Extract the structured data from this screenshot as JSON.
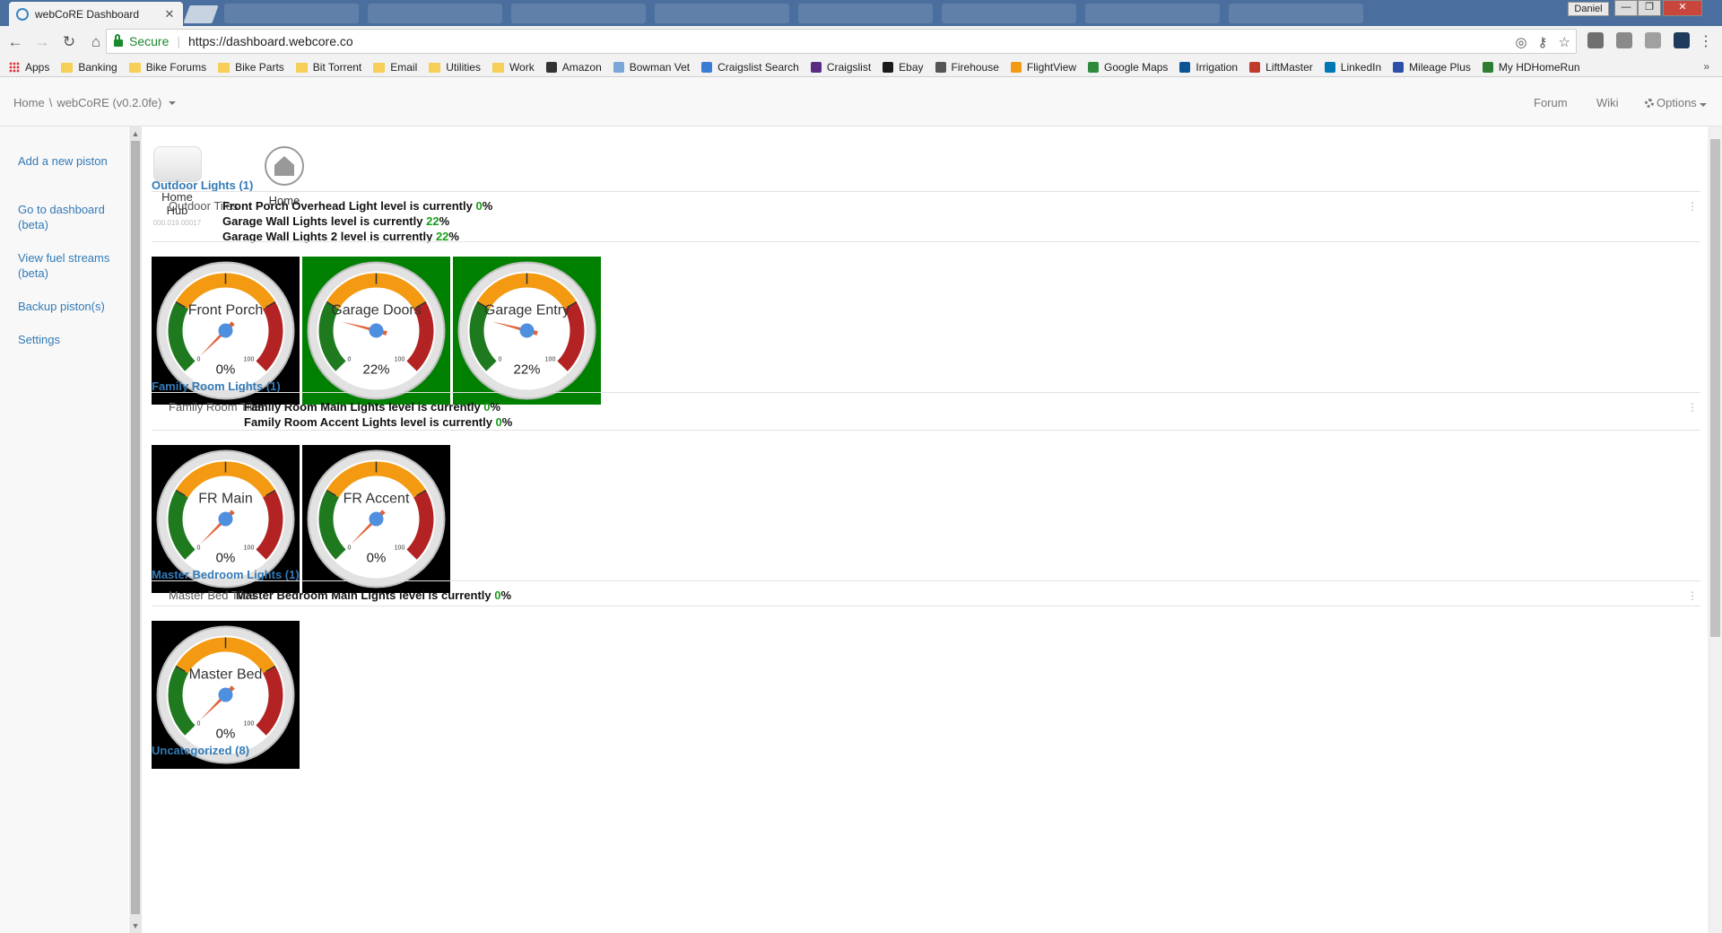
{
  "browser": {
    "tab_title": "webCoRE Dashboard",
    "security_label": "Secure",
    "url": "https://dashboard.webcore.co",
    "profile_name": "Daniel"
  },
  "bookmarks": [
    "Apps",
    "Banking",
    "Bike Forums",
    "Bike Parts",
    "Bit Torrent",
    "Email",
    "Utilities",
    "Work",
    "Amazon",
    "Bowman Vet",
    "Craigslist Search",
    "Craigslist",
    "Ebay",
    "Firehouse",
    "FlightView",
    "Google Maps",
    "Irrigation",
    "LiftMaster",
    "LinkedIn",
    "Mileage Plus",
    "My HDHomeRun"
  ],
  "header": {
    "home": "Home",
    "separator": "\\",
    "app": "webCoRE (v0.2.0fe)",
    "forum": "Forum",
    "wiki": "Wiki",
    "options": "Options"
  },
  "sidebar": {
    "items": [
      {
        "label": "Add a new piston"
      },
      {
        "label": "Go to dashboard (beta)"
      },
      {
        "label": "View fuel streams (beta)"
      },
      {
        "label": "Backup piston(s)"
      },
      {
        "label": "Settings"
      }
    ]
  },
  "devices": [
    {
      "label": "Home Hub",
      "sub": "000.019.00017",
      "icon": "hub-icon"
    },
    {
      "label": "Home",
      "sub": "",
      "icon": "home-icon"
    }
  ],
  "categories": [
    {
      "title": "Outdoor Lights (1)",
      "piston": "Outdoor Tiles",
      "lines": [
        {
          "prefix": "Front Porch Overhead Light level is currently ",
          "value": "0",
          "suffix": "%"
        },
        {
          "prefix": "Garage Wall Lights level is currently ",
          "value": "22",
          "suffix": "%"
        },
        {
          "prefix": "Garage Wall Lights 2 level is currently ",
          "value": "22",
          "suffix": "%"
        }
      ],
      "gauges": [
        {
          "label": "Front Porch",
          "value": 0,
          "unit": "%",
          "bg": "#000000"
        },
        {
          "label": "Garage Doors",
          "value": 22,
          "unit": "%",
          "bg": "#008000"
        },
        {
          "label": "Garage Entry",
          "value": 22,
          "unit": "%",
          "bg": "#008000"
        }
      ]
    },
    {
      "title": "Family Room Lights (1)",
      "piston": "Family Room Tiles",
      "lines": [
        {
          "prefix": "Family Room Main Lights level is currently ",
          "value": "0",
          "suffix": "%"
        },
        {
          "prefix": "Family Room Accent Lights level is currently ",
          "value": "0",
          "suffix": "%"
        }
      ],
      "gauges": [
        {
          "label": "FR Main",
          "value": 0,
          "unit": "%",
          "bg": "#000000"
        },
        {
          "label": "FR Accent",
          "value": 0,
          "unit": "%",
          "bg": "#000000"
        }
      ]
    },
    {
      "title": "Master Bedroom Lights (1)",
      "piston": "Master Bed Tiles",
      "lines": [
        {
          "prefix": "Master Bedroom Main Lights level is currently ",
          "value": "0",
          "suffix": "%"
        }
      ],
      "gauges": [
        {
          "label": "Master Bed",
          "value": 0,
          "unit": "%",
          "bg": "#000000"
        }
      ]
    },
    {
      "title": "Uncategorized (8)"
    }
  ],
  "gauge_scale": {
    "min": "0",
    "max": "100"
  },
  "colors": {
    "link": "#337ab7",
    "level_value": "#1a9d1a",
    "gauge_green": "#1f7a1f",
    "gauge_orange": "#f39a12",
    "gauge_red": "#b42323",
    "needle": "#e0623a",
    "hub": "#4f8fe0"
  }
}
